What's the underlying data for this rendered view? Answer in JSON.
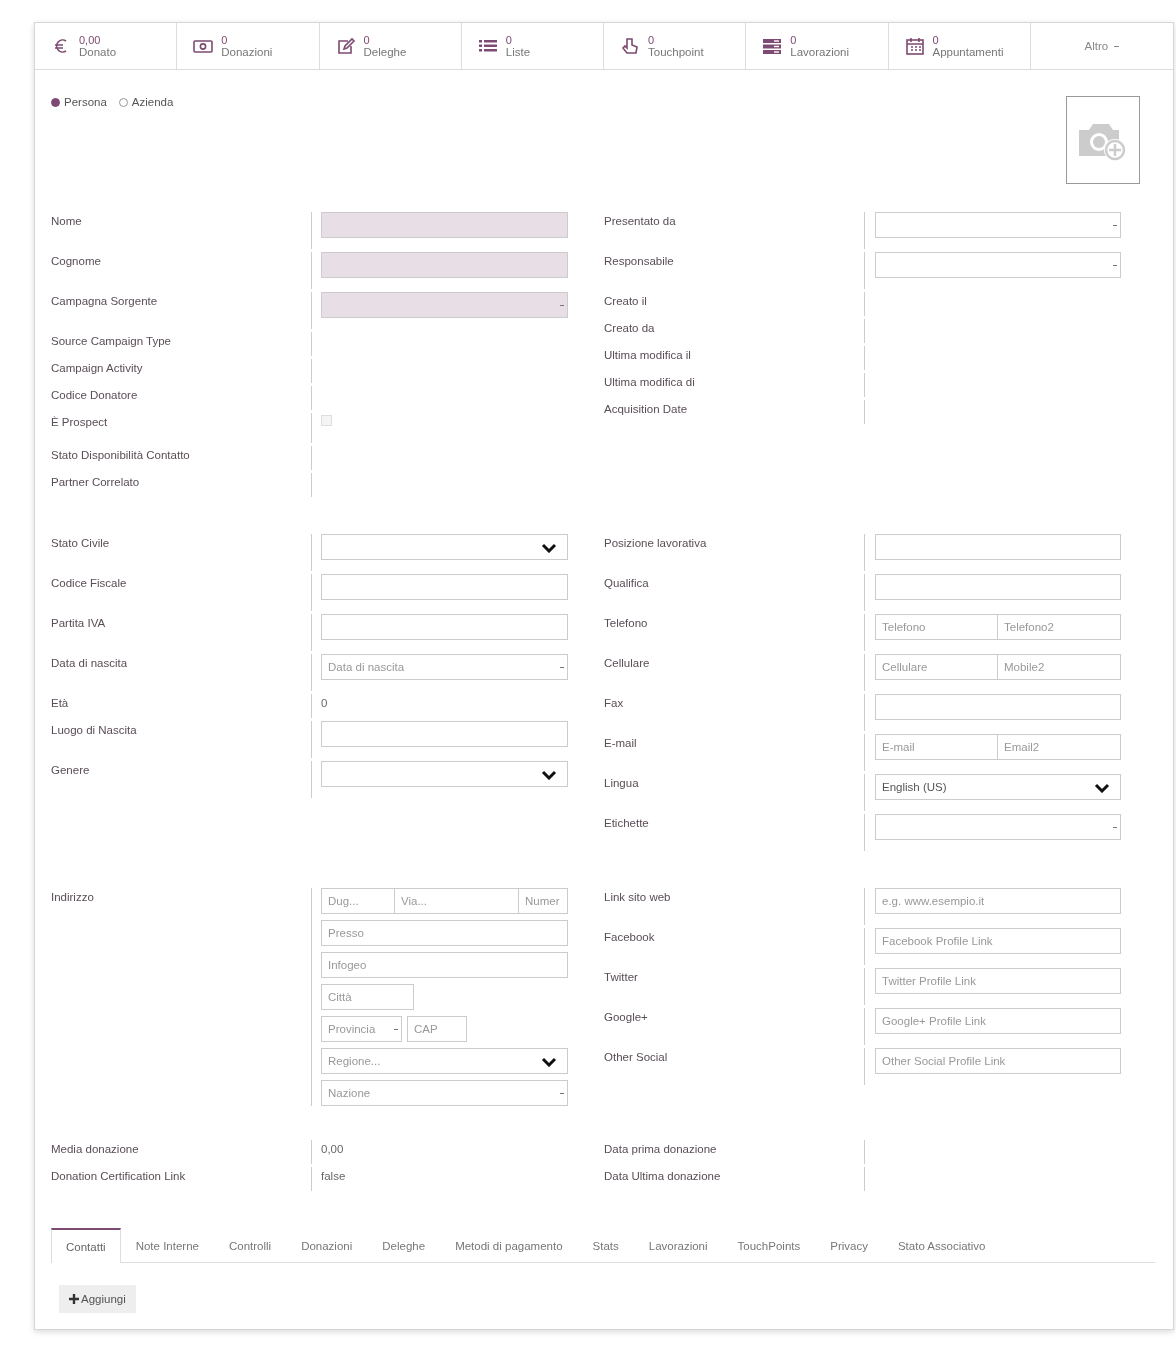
{
  "stat_buttons": [
    {
      "value": "0,00",
      "label": "Donato"
    },
    {
      "value": "0",
      "label": "Donazioni"
    },
    {
      "value": "0",
      "label": "Deleghe"
    },
    {
      "value": "0",
      "label": "Liste"
    },
    {
      "value": "0",
      "label": "Touchpoint"
    },
    {
      "value": "0",
      "label": "Lavorazioni"
    },
    {
      "value": "0",
      "label": "Appuntamenti"
    }
  ],
  "more_button": {
    "label": "Altro"
  },
  "partner_type": [
    {
      "label": "Persona",
      "selected": true
    },
    {
      "label": "Azienda",
      "selected": false
    }
  ],
  "sections": [
    {
      "left": [
        {
          "label": "Nome",
          "kind": "input",
          "required": true
        },
        {
          "label": "Cognome",
          "kind": "input",
          "required": true
        },
        {
          "label": "Campagna Sorgente",
          "kind": "many2one",
          "required": true
        },
        {
          "label": "Source Campaign Type",
          "kind": "none"
        },
        {
          "label": "Campaign Activity",
          "kind": "none"
        },
        {
          "label": "Codice Donatore",
          "kind": "none"
        },
        {
          "label": "È Prospect",
          "kind": "checkbox",
          "checked": false
        },
        {
          "label": "Stato Disponibilità Contatto",
          "kind": "none"
        },
        {
          "label": "Partner Correlato",
          "kind": "none"
        }
      ],
      "right": [
        {
          "label": "Presentato da",
          "kind": "many2one",
          "required": false
        },
        {
          "label": "Responsabile",
          "kind": "many2one",
          "required": false
        },
        {
          "label": "Creato il",
          "kind": "none"
        },
        {
          "label": "Creato da",
          "kind": "none"
        },
        {
          "label": "Ultima modifica il",
          "kind": "none"
        },
        {
          "label": "Ultima modifica di",
          "kind": "none"
        },
        {
          "label": "Acquisition Date",
          "kind": "none"
        }
      ]
    },
    {
      "left": [
        {
          "label": "Stato Civile",
          "kind": "select"
        },
        {
          "label": "Codice Fiscale",
          "kind": "input",
          "required": false
        },
        {
          "label": "Partita IVA",
          "kind": "input",
          "required": false
        },
        {
          "label": "Data di nascita",
          "kind": "many2one",
          "required": false,
          "placeholder": "Data di nascita"
        },
        {
          "label": "Età",
          "kind": "text",
          "value": "0"
        },
        {
          "label": "Luogo di Nascita",
          "kind": "input",
          "required": false
        },
        {
          "label": "Genere",
          "kind": "select"
        }
      ],
      "right": [
        {
          "label": "Posizione lavorativa",
          "kind": "input",
          "required": false
        },
        {
          "label": "Qualifica",
          "kind": "input",
          "required": false
        },
        {
          "label": "Telefono",
          "kind": "pair",
          "placeholders": [
            "Telefono",
            "Telefono2"
          ]
        },
        {
          "label": "Cellulare",
          "kind": "pair",
          "placeholders": [
            "Cellulare",
            "Mobile2"
          ]
        },
        {
          "label": "Fax",
          "kind": "input",
          "required": false
        },
        {
          "label": "E-mail",
          "kind": "pair",
          "placeholders": [
            "E-mail",
            "Email2"
          ]
        },
        {
          "label": "Lingua",
          "kind": "select",
          "value": "English (US)"
        },
        {
          "label": "Etichette",
          "kind": "many2one",
          "required": false
        }
      ]
    },
    {
      "left": [
        {
          "label": "Indirizzo",
          "kind": "address",
          "rows": [
            [
              {
                "kind": "input",
                "placeholder": "Dug..."
              },
              {
                "kind": "input",
                "placeholder": "Via..."
              },
              {
                "kind": "input",
                "placeholder": "Numer"
              }
            ],
            [
              {
                "kind": "input",
                "placeholder": "Presso"
              }
            ],
            [
              {
                "kind": "input",
                "placeholder": "Infogeo"
              }
            ],
            [
              {
                "kind": "input",
                "placeholder": "Città"
              }
            ],
            [
              {
                "kind": "many2one",
                "placeholder": "Provincia"
              },
              {
                "kind": "input",
                "placeholder": "CAP"
              }
            ],
            [
              {
                "kind": "select",
                "placeholder": "Regione..."
              }
            ],
            [
              {
                "kind": "many2one",
                "placeholder": "Nazione"
              }
            ]
          ]
        }
      ],
      "right": [
        {
          "label": "Link sito web",
          "kind": "input",
          "required": false,
          "placeholder": "e.g. www.esempio.it"
        },
        {
          "label": "Facebook",
          "kind": "input",
          "required": false,
          "placeholder": "Facebook Profile Link"
        },
        {
          "label": "Twitter",
          "kind": "input",
          "required": false,
          "placeholder": "Twitter Profile Link"
        },
        {
          "label": "Google+",
          "kind": "input",
          "required": false,
          "placeholder": "Google+ Profile Link"
        },
        {
          "label": "Other Social",
          "kind": "input",
          "required": false,
          "placeholder": "Other Social Profile Link"
        }
      ]
    },
    {
      "left": [
        {
          "label": "Media donazione",
          "kind": "text",
          "value": "0,00"
        },
        {
          "label": "Donation Certification Link",
          "kind": "text",
          "value": "false"
        }
      ],
      "right": [
        {
          "label": "Data prima donazione",
          "kind": "none"
        },
        {
          "label": "Data Ultima donazione",
          "kind": "none"
        }
      ]
    }
  ],
  "tabs": [
    {
      "label": "Contatti",
      "selected": true
    },
    {
      "label": "Note Interne",
      "selected": false
    },
    {
      "label": "Controlli",
      "selected": false
    },
    {
      "label": "Donazioni",
      "selected": false
    },
    {
      "label": "Deleghe",
      "selected": false
    },
    {
      "label": "Metodi di pagamento",
      "selected": false
    },
    {
      "label": "Stats",
      "selected": false
    },
    {
      "label": "Lavorazioni",
      "selected": false
    },
    {
      "label": "TouchPoints",
      "selected": false
    },
    {
      "label": "Privacy",
      "selected": false
    },
    {
      "label": "Stato Associativo",
      "selected": false
    }
  ],
  "add_button": {
    "label": "Aggiungi"
  }
}
